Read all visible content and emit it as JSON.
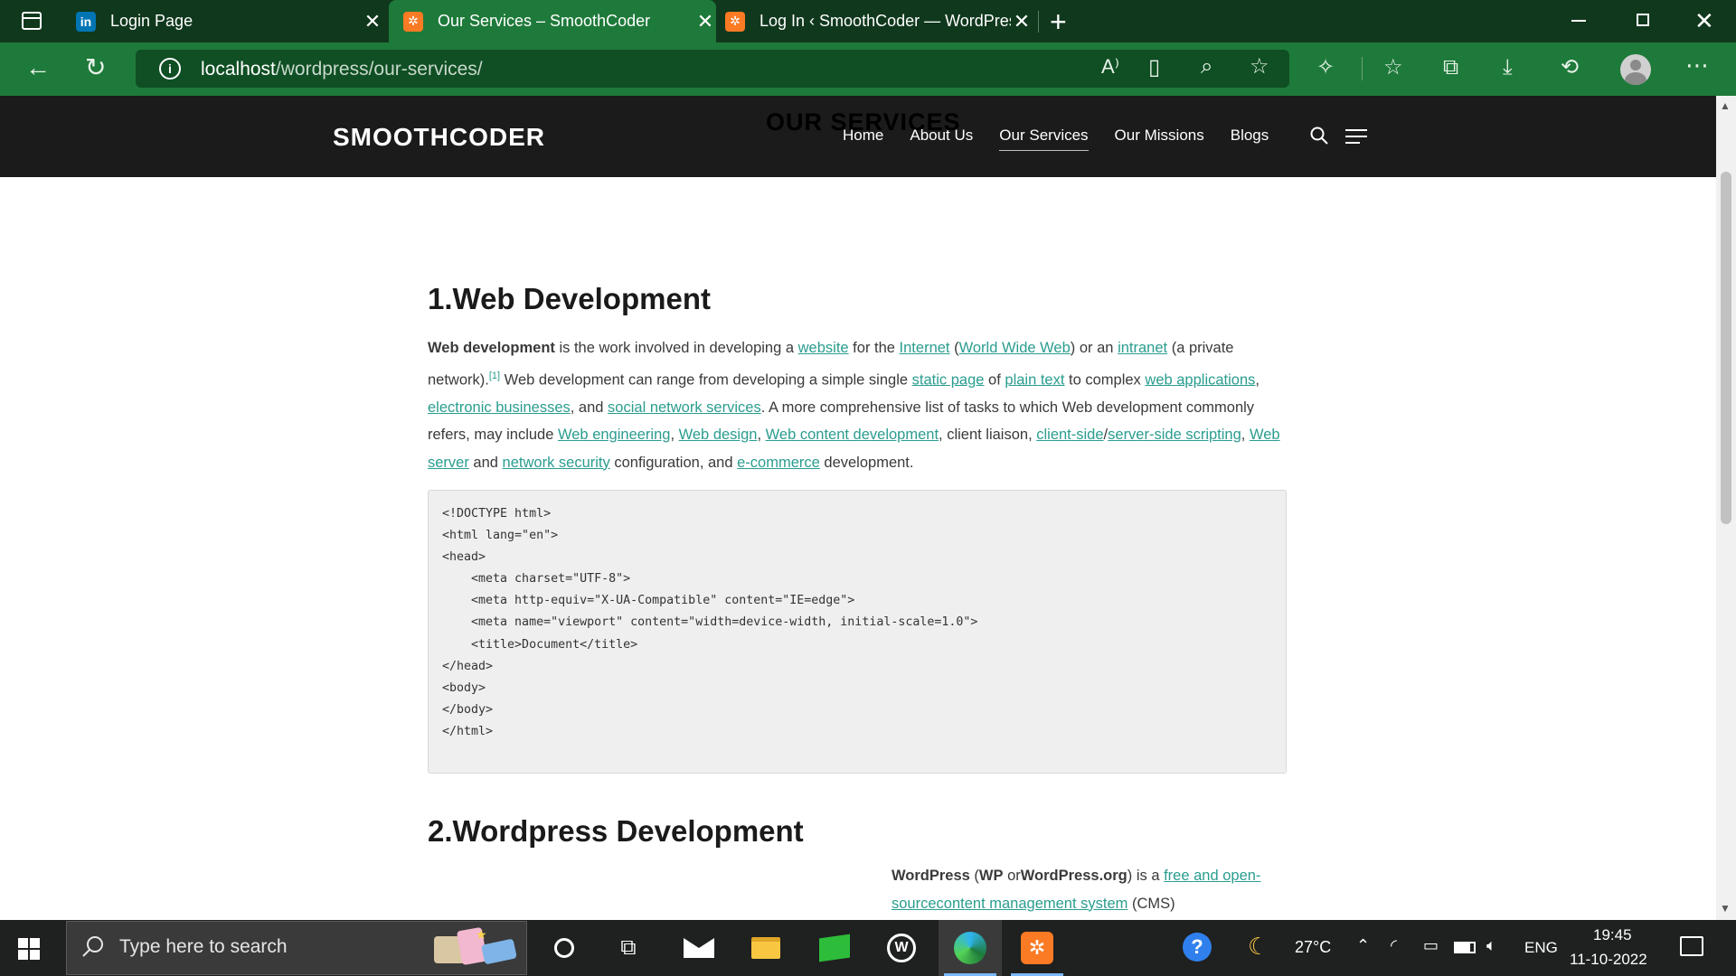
{
  "browser": {
    "tabs": [
      {
        "title": "Login Page",
        "favicon": "invision-icon"
      },
      {
        "title": "Our Services – SmoothCoder",
        "favicon": "xampp-icon",
        "active": true
      },
      {
        "title": "Log In ‹ SmoothCoder — WordPress",
        "favicon": "xampp-icon"
      }
    ],
    "url_host": "localhost",
    "url_path": "/wordpress/our-services/"
  },
  "site": {
    "logo": "SMOOTHCODER",
    "ghost_title": "OUR SERVICES",
    "nav": [
      {
        "label": "Home"
      },
      {
        "label": "About Us"
      },
      {
        "label": "Our Services",
        "active": true
      },
      {
        "label": "Our Missions"
      },
      {
        "label": "Blogs"
      }
    ]
  },
  "article": {
    "section1_title": "1.Web Development",
    "p1": {
      "bold": "Web development",
      "t1": " is the work involved in developing a ",
      "l_website": "website",
      "t2": " for the ",
      "l_internet": "Internet",
      "t3": " (",
      "l_www": "World Wide Web",
      "t4": ") or an ",
      "l_intranet": "intranet",
      "t5": " (a private network).",
      "sup": "[1]",
      "t6": " Web development can range from developing a simple single ",
      "l_static": "static page",
      "t7": " of ",
      "l_plain": "plain text",
      "t8": " to complex ",
      "l_webapps": "web applications",
      "t9": ", ",
      "l_ebiz": "electronic businesses",
      "t10": ", and ",
      "l_social": "social network services",
      "t11": ". A more comprehensive list of tasks to which Web development commonly refers, may include ",
      "l_weng": "Web engineering",
      "t12": ", ",
      "l_wdesign": "Web design",
      "t13": ", ",
      "l_wcontent": "Web content development",
      "t14": ", client liaison, ",
      "l_client": "client-side",
      "t15": "/",
      "l_server": "server-side scripting",
      "t16": ", ",
      "l_webserver": "Web server",
      "t17": " and ",
      "l_netsec": "network security",
      "t18": " configuration, and ",
      "l_ecom": "e-commerce",
      "t19": " development."
    },
    "code_lines": [
      "<!DOCTYPE html>",
      "<html lang=\"en\">",
      "<head>",
      "    <meta charset=\"UTF-8\">",
      "    <meta http-equiv=\"X-UA-Compatible\" content=\"IE=edge\">",
      "    <meta name=\"viewport\" content=\"width=device-width, initial-scale=1.0\">",
      "    <title>Document</title>",
      "</head>",
      "<body>",
      "",
      "</body>",
      "</html>"
    ],
    "section2_title": "2.Wordpress Development",
    "p2": {
      "bold1": "WordPress",
      "t1": " (",
      "bold2": "WP",
      "t2": " or",
      "bold3": "WordPress.org",
      "t3": ") is a ",
      "l_free": "free and open-source",
      "l_cms": "content management system",
      "t4": " (CMS)"
    }
  },
  "taskbar": {
    "search_placeholder": "Type here to search",
    "weather": "27°C",
    "language": "ENG",
    "time": "19:45",
    "date": "11-10-2022"
  }
}
